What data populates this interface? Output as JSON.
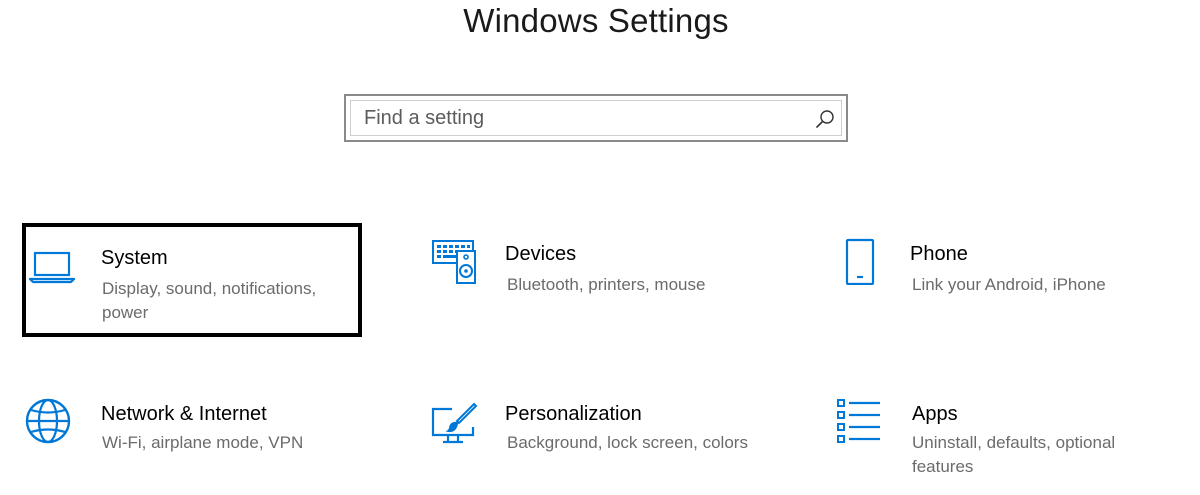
{
  "page": {
    "title": "Windows Settings"
  },
  "search": {
    "placeholder": "Find a setting",
    "icon": "search-icon"
  },
  "colors": {
    "accent": "#0078d7",
    "selection_border": "#000000",
    "description_text": "#6b6b6b"
  },
  "tiles": [
    {
      "label": "System",
      "description": "Display, sound, notifications, power",
      "icon": "laptop-icon",
      "selected": true
    },
    {
      "label": "Devices",
      "description": "Bluetooth, printers, mouse",
      "icon": "keyboard-speaker-icon",
      "selected": false
    },
    {
      "label": "Phone",
      "description": "Link your Android, iPhone",
      "icon": "phone-icon",
      "selected": false
    },
    {
      "label": "Network & Internet",
      "description": "Wi-Fi, airplane mode, VPN",
      "icon": "globe-icon",
      "selected": false
    },
    {
      "label": "Personalization",
      "description": "Background, lock screen, colors",
      "icon": "paint-brush-icon",
      "selected": false
    },
    {
      "label": "Apps",
      "description": "Uninstall, defaults, optional features",
      "icon": "apps-list-icon",
      "selected": false
    }
  ]
}
